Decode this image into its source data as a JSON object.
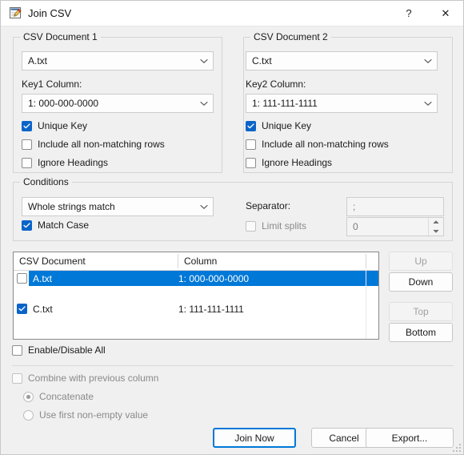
{
  "window": {
    "title": "Join CSV",
    "icon": "notepad-pencil-icon",
    "help_label": "?",
    "close_label": "✕"
  },
  "doc1": {
    "group_title": "CSV Document 1",
    "file_value": "A.txt",
    "key_label": "Key1 Column:",
    "key_value": "1: 000-000-0000",
    "unique_key": {
      "label": "Unique Key",
      "checked": true
    },
    "include_non_matching": {
      "label": "Include all non-matching rows",
      "checked": false
    },
    "ignore_headings": {
      "label": "Ignore Headings",
      "checked": false
    }
  },
  "doc2": {
    "group_title": "CSV Document 2",
    "file_value": "C.txt",
    "key_label": "Key2 Column:",
    "key_value": "1: 111-111-1111",
    "unique_key": {
      "label": "Unique Key",
      "checked": true
    },
    "include_non_matching": {
      "label": "Include all non-matching rows",
      "checked": false
    },
    "ignore_headings": {
      "label": "Ignore Headings",
      "checked": false
    }
  },
  "conditions": {
    "group_title": "Conditions",
    "match_mode_value": "Whole strings match",
    "match_case": {
      "label": "Match Case",
      "checked": true
    },
    "separator_label": "Separator:",
    "separator_value": ";",
    "limit_splits": {
      "label": "Limit splits",
      "checked": false
    },
    "limit_splits_value": "0"
  },
  "table": {
    "columns": [
      "CSV Document",
      "Column"
    ],
    "rows": [
      {
        "document": "A.txt",
        "column": "1: 000-000-0000",
        "checked": false,
        "selected": true
      },
      {
        "document": "C.txt",
        "column": "1: 111-111-1111",
        "checked": true,
        "selected": false
      }
    ]
  },
  "order_buttons": {
    "up": "Up",
    "down": "Down",
    "top": "Top",
    "bottom": "Bottom"
  },
  "enable_all": {
    "label": "Enable/Disable All",
    "checked": false
  },
  "combine": {
    "checkbox_label": "Combine with previous column",
    "checked": false,
    "radio_concatenate": "Concatenate",
    "radio_first_non_empty": "Use first non-empty value",
    "selected_radio": "Concatenate"
  },
  "footer": {
    "join_now": "Join Now",
    "cancel": "Cancel",
    "export": "Export..."
  },
  "colors": {
    "accent": "#0078d7",
    "checkbox_checked": "#0a64c8",
    "dialog_bg": "#f0f0f0",
    "selection_bg": "#0078d7"
  }
}
